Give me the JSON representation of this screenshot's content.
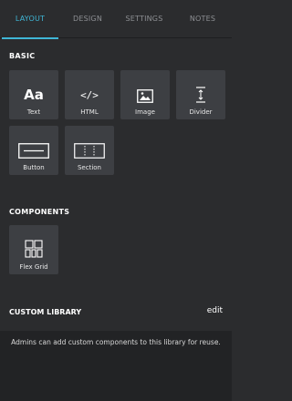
{
  "tabs": [
    {
      "label": "LAYOUT",
      "active": true
    },
    {
      "label": "DESIGN",
      "active": false
    },
    {
      "label": "SETTINGS",
      "active": false
    },
    {
      "label": "NOTES",
      "active": false
    }
  ],
  "basic": {
    "title": "BASIC",
    "items": [
      {
        "label": "Text",
        "glyph": "Aa",
        "icon": "text-icon"
      },
      {
        "label": "HTML",
        "glyph": "</>",
        "icon": "code-icon"
      },
      {
        "label": "Image",
        "icon": "image-icon"
      },
      {
        "label": "Divider",
        "icon": "divider-icon"
      },
      {
        "label": "Button",
        "icon": "button-icon"
      },
      {
        "label": "Section",
        "icon": "section-icon"
      }
    ]
  },
  "components": {
    "title": "COMPONENTS",
    "items": [
      {
        "label": "Flex Grid",
        "icon": "flex-grid-icon"
      }
    ]
  },
  "library": {
    "title": "CUSTOM LIBRARY",
    "edit_label": "edit",
    "message": "Admins can add custom components to this library for reuse."
  },
  "colors": {
    "accent": "#3fb6d6",
    "background": "#2b2c2e",
    "tile": "#3d3f43"
  }
}
